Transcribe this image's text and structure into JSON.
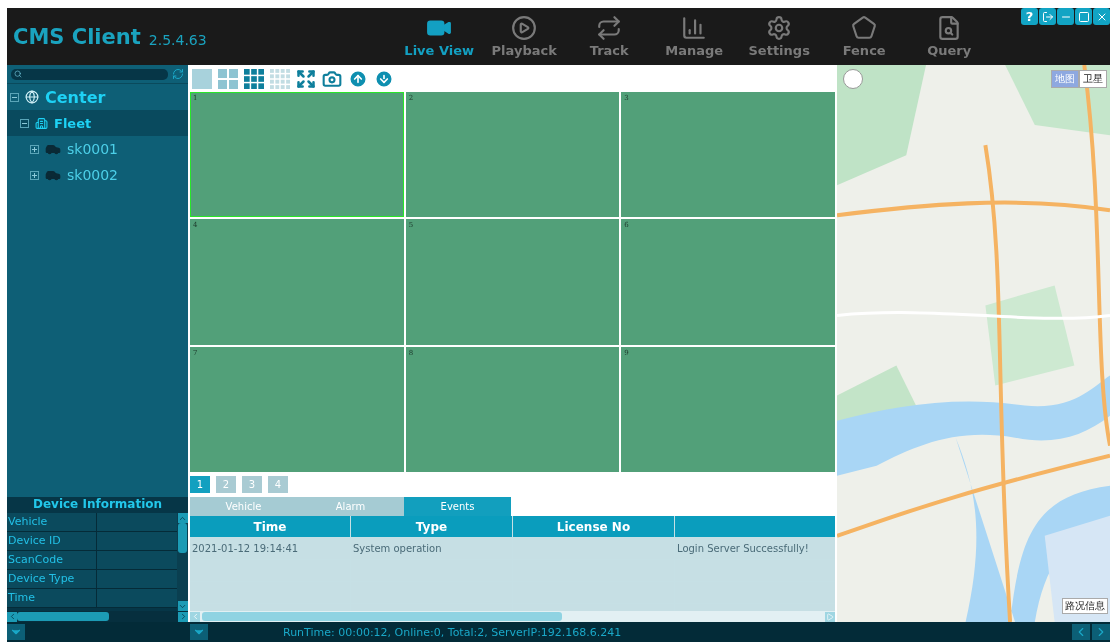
{
  "header": {
    "title": "CMS Client",
    "version": "2.5.4.63",
    "nav": [
      {
        "kind": "live",
        "label": "Live View",
        "selected": true
      },
      {
        "kind": "playback",
        "label": "Playback",
        "selected": false
      },
      {
        "kind": "track",
        "label": "Track",
        "selected": false
      },
      {
        "kind": "manage",
        "label": "Manage",
        "selected": false
      },
      {
        "kind": "settings",
        "label": "Settings",
        "selected": false
      },
      {
        "kind": "fence",
        "label": "Fence",
        "selected": false
      },
      {
        "kind": "query",
        "label": "Query",
        "selected": false
      }
    ],
    "window_buttons": [
      {
        "kind": "help",
        "label": "?"
      },
      {
        "kind": "logout"
      },
      {
        "kind": "minimize"
      },
      {
        "kind": "maximize"
      },
      {
        "kind": "close"
      }
    ]
  },
  "tree": [
    {
      "kind": "center",
      "label": "Center",
      "expanded": true,
      "selected": false,
      "children": [
        {
          "kind": "fleet",
          "label": "Fleet",
          "expanded": true,
          "selected": true,
          "children": [
            {
              "kind": "vehicle",
              "label": "sk0001",
              "expanded": false,
              "selected": false
            },
            {
              "kind": "vehicle",
              "label": "sk0002",
              "expanded": false,
              "selected": false
            }
          ]
        }
      ]
    }
  ],
  "device_info": {
    "title": "Device Information",
    "rows": [
      "Vehicle",
      "Device ID",
      "ScanCode",
      "Device Type",
      "Time"
    ]
  },
  "video": {
    "layouts": [
      {
        "kind": "single",
        "selected": false
      },
      {
        "kind": "quad",
        "selected": false
      },
      {
        "kind": "nine",
        "selected": true
      },
      {
        "kind": "sixteen",
        "selected": false
      }
    ],
    "channels": [
      {
        "label": "1",
        "selected": true
      },
      {
        "label": "2",
        "selected": false
      },
      {
        "label": "3",
        "selected": false
      },
      {
        "label": "4",
        "selected": false
      },
      {
        "label": "5",
        "selected": false
      },
      {
        "label": "6",
        "selected": false
      },
      {
        "label": "7",
        "selected": false
      },
      {
        "label": "8",
        "selected": false
      },
      {
        "label": "9",
        "selected": false
      }
    ],
    "pages": [
      {
        "label": "1",
        "selected": true
      },
      {
        "label": "2",
        "selected": false
      },
      {
        "label": "3",
        "selected": false
      },
      {
        "label": "4",
        "selected": false
      }
    ]
  },
  "log": {
    "tabs": [
      {
        "label": "Vehicle",
        "selected": false
      },
      {
        "label": "Alarm",
        "selected": false
      },
      {
        "label": "Events",
        "selected": true
      }
    ],
    "columns": [
      "Time",
      "Type",
      "License No"
    ],
    "rows": [
      {
        "time": "2021-01-12 19:14:41",
        "type": "System operation",
        "message": "Login Server Successfully!"
      }
    ]
  },
  "map": {
    "kind": "picture",
    "map_types": [
      {
        "label": "地图",
        "selected": true
      },
      {
        "label": "卫星",
        "selected": false
      }
    ],
    "traffic": "路况信息"
  },
  "status_bar": "RunTime: 00:00:12, Online:0, Total:2, ServerIP:192.168.6.241"
}
